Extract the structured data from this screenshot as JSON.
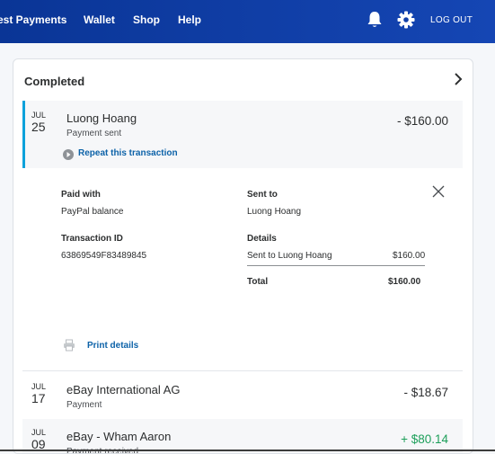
{
  "nav": {
    "items": [
      "est Payments",
      "Wallet",
      "Shop",
      "Help"
    ],
    "logout": "LOG OUT"
  },
  "icons": {
    "bell": "bell-icon",
    "settings": "gear-icon",
    "chevron": "chevron-right-icon",
    "repeat": "repeat-arrow-icon",
    "close": "close-icon",
    "print": "printer-icon"
  },
  "colors": {
    "header": "#0a3596",
    "link": "#0c62a8",
    "accent": "#0ca1db",
    "positive": "#1d9f5a"
  },
  "section": {
    "title": "Completed"
  },
  "transactions": [
    {
      "month": "JUL",
      "day": "25",
      "name": "Luong Hoang",
      "type": "Payment sent",
      "amount": "- $160.00",
      "action": "Repeat this transaction"
    },
    {
      "month": "JUL",
      "day": "17",
      "name": "eBay International AG",
      "type": "Payment",
      "amount": "- $18.67"
    },
    {
      "month": "JUL",
      "day": "09",
      "name": "eBay - Wham Aaron",
      "type": "Payment received",
      "amount": "+ $80.14"
    }
  ],
  "details": {
    "paid_with_label": "Paid with",
    "paid_with_value": "PayPal balance",
    "sent_to_label": "Sent to",
    "sent_to_value": "Luong Hoang",
    "transaction_id_label": "Transaction ID",
    "transaction_id_value": "63869549F83489845",
    "details_label": "Details",
    "line_item": "Sent to Luong Hoang",
    "line_amount": "$160.00",
    "total_label": "Total",
    "total_amount": "$160.00",
    "print": "Print details"
  }
}
